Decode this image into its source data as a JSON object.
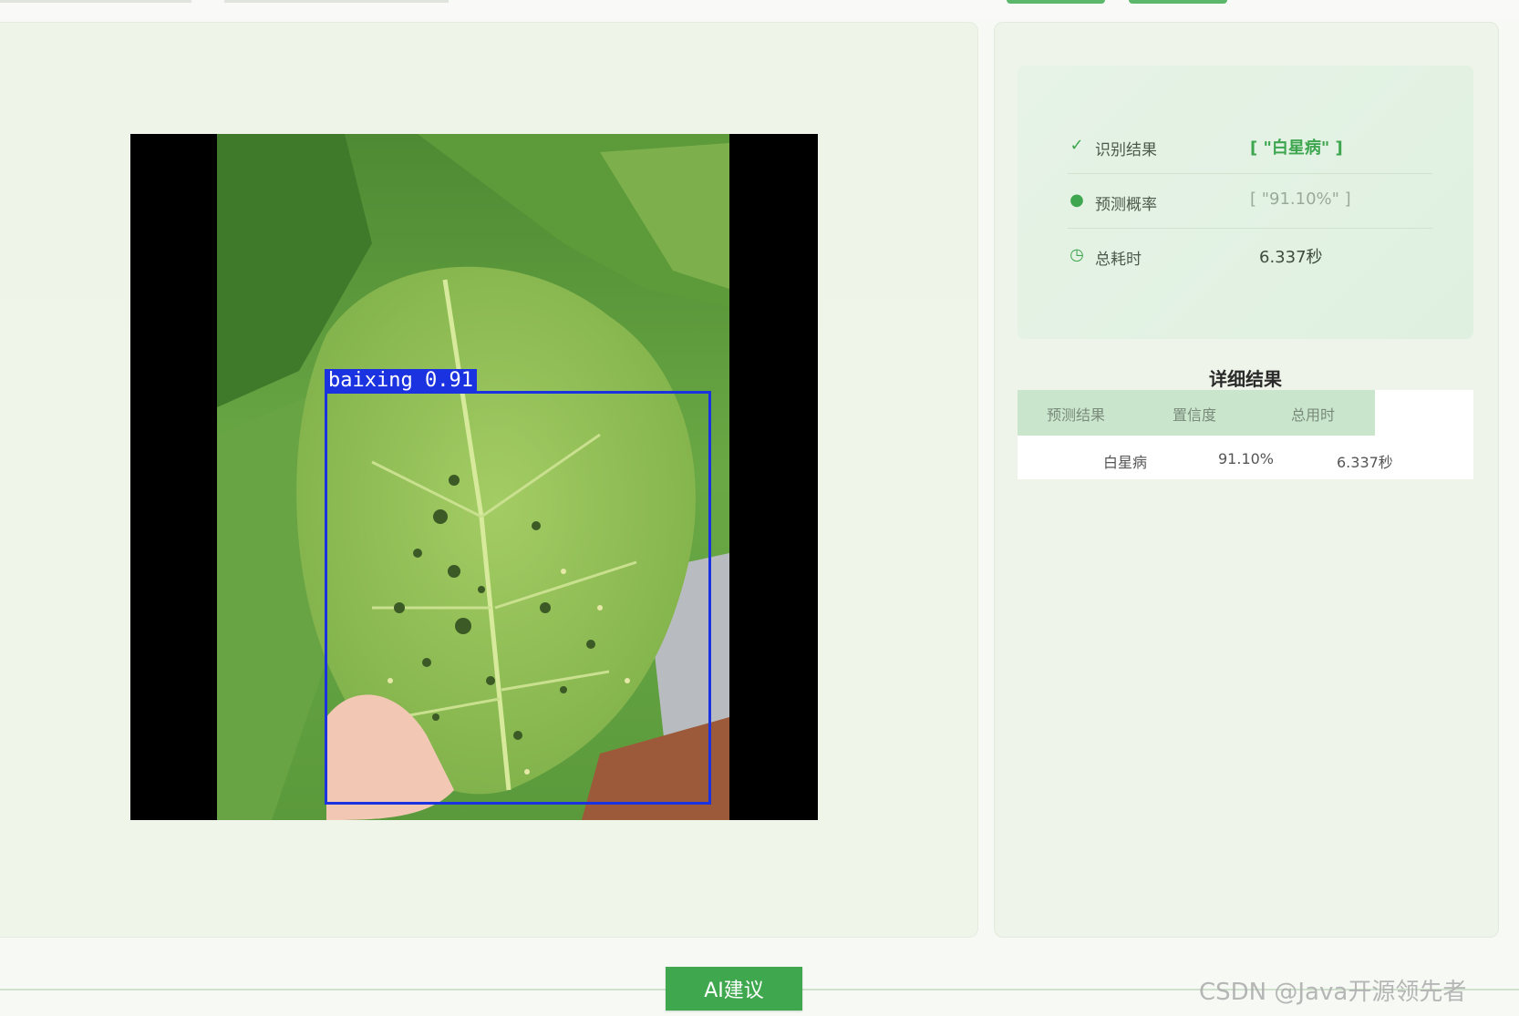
{
  "detection": {
    "label": "baixing 0.91"
  },
  "summary": {
    "rows": [
      {
        "icon": "check-icon",
        "label": "识别结果",
        "value": "[ \"白星病\" ]"
      },
      {
        "icon": "location-pin-icon",
        "label": "预测概率",
        "value": "[ \"91.10%\" ]"
      },
      {
        "icon": "clock-icon",
        "label": "总耗时",
        "value": "6.337秒"
      }
    ]
  },
  "details": {
    "title": "详细结果",
    "headers": [
      "预测结果",
      "置信度",
      "总用时"
    ],
    "row": [
      "白星病",
      "91.10%",
      "6.337秒"
    ]
  },
  "footer": {
    "ai_button_label": "AI建议",
    "watermark": "CSDN @Java开源领先者"
  },
  "colors": {
    "accent": "#3fa84e",
    "detection_box": "#1a32e0"
  }
}
